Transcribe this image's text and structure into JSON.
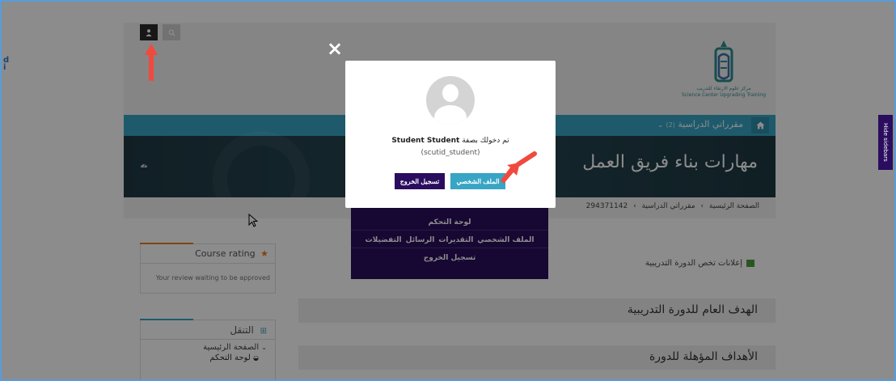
{
  "edge": {
    "text_1": "d",
    "text_2": "i"
  },
  "topbar": {
    "user_icon": "user-icon",
    "search_icon": "search-icon"
  },
  "logo": {
    "caption": "مركز علوم الارتقاء للتدريب",
    "caption_en": "Science Center Upgrading Training"
  },
  "navbar": {
    "courses_label": "مقرراتي الدراسية",
    "courses_count": "(2)",
    "home_icon": "home-icon"
  },
  "banner": {
    "title": "مهارات بناء فريق العمل",
    "dashboard_icon": "dashboard-icon"
  },
  "breadcrumb": {
    "home": "الصفحة الرئيسية",
    "sep": "›",
    "courses": "مقرراتي الدراسية",
    "code": "294371142"
  },
  "main": {
    "announcements": "إعلانات تخص الدورة التدريبية",
    "section_1": "الهدف العام للدورة التدريبية",
    "section_2": "الأهداف المؤهلة للدورة"
  },
  "sidebar": {
    "rating_title": "Course rating",
    "rating_message": "Your review waiting to be approved",
    "nav_title": "التنقل",
    "nav_home": "الصفحة الرئيسية",
    "nav_dashboard": "لوحة التحكم"
  },
  "user_menu": {
    "dashboard": "لوحة التحكم",
    "profile": "الملف الشخصي",
    "grades": "التقديرات",
    "messages": "الرسائل",
    "preferences": "التفضيلات",
    "logout": "تسجيل الخروج"
  },
  "modal": {
    "close": "×",
    "logged_prefix": "تم دخولك بصفة",
    "user_full_name": "Student Student",
    "username": "(scutid_student)",
    "profile_button": "الملف الشخصي",
    "logout_button": "تسجيل الخروج"
  },
  "hide_sidebars": "Hide sidebars",
  "colors": {
    "accent_teal": "#38a5c4",
    "dark_purple": "#2a0d5e",
    "banner_dark": "#1f3a44",
    "orange": "#e67e22",
    "annotation_red": "#f04a3e"
  }
}
